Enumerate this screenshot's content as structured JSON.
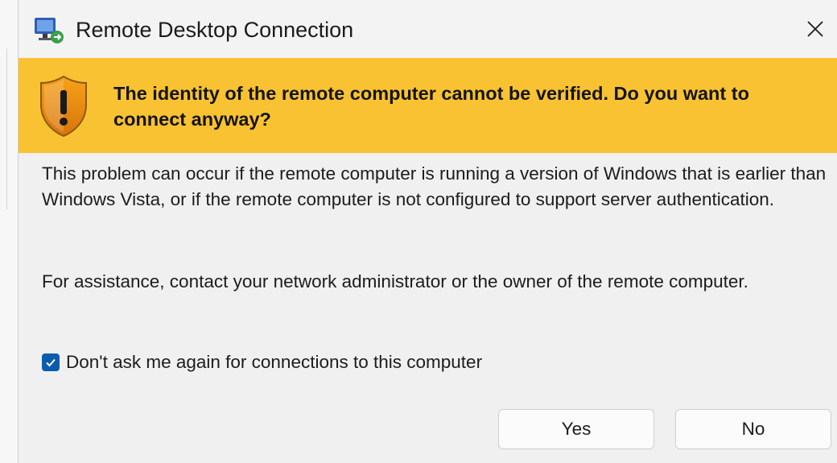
{
  "window": {
    "title": "Remote Desktop Connection",
    "app_icon": "remote-desktop-icon",
    "close_icon": "close-icon"
  },
  "warning": {
    "icon": "shield-warning-icon",
    "text": "The identity of the remote computer cannot be verified. Do you want to connect anyway?",
    "color": "#f9c232"
  },
  "body": {
    "paragraph_1": "This problem can occur if the remote computer is running a version of Windows that is earlier than Windows Vista, or if the remote computer is not configured to support server authentication.",
    "paragraph_2": "For assistance, contact your network administrator or the owner of the remote computer."
  },
  "checkbox": {
    "label": "Don't ask me again for connections to this computer",
    "checked": true,
    "color": "#0b5cad"
  },
  "buttons": {
    "yes_label": "Yes",
    "no_label": "No"
  }
}
